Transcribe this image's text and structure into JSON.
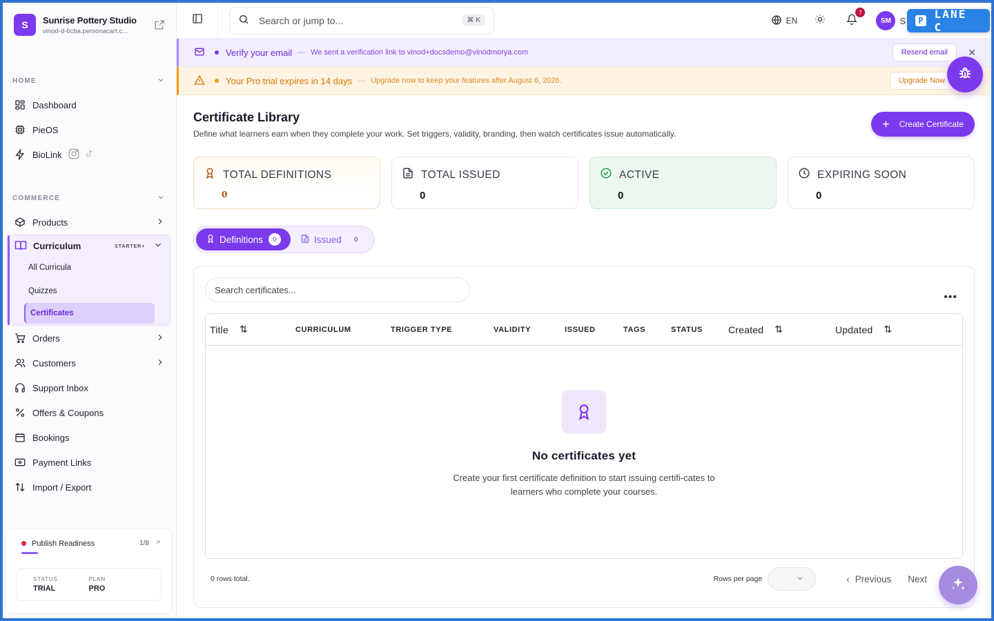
{
  "brand": {
    "initial": "S",
    "name": "Sunrise Pottery Studio",
    "subdomain": "vinod-d-6cba.personacart.c..."
  },
  "sidebar": {
    "home_label": "HOME",
    "commerce_label": "COMMERCE",
    "home_items": [
      {
        "label": "Dashboard",
        "icon": "grid-icon"
      },
      {
        "label": "PieOS",
        "icon": "chip-icon"
      },
      {
        "label": "BioLink",
        "icon": "bolt-icon"
      }
    ],
    "products_label": "Products",
    "curriculum": {
      "label": "Curriculum",
      "badge": "STARTER+",
      "items": [
        "All Curricula",
        "Quizzes",
        "Certificates"
      ]
    },
    "commerce_items": [
      {
        "label": "Orders",
        "has_chevron": true
      },
      {
        "label": "Customers",
        "has_chevron": true
      },
      {
        "label": "Support Inbox"
      },
      {
        "label": "Offers & Coupons"
      },
      {
        "label": "Bookings"
      },
      {
        "label": "Payment Links"
      },
      {
        "label": "Import / Export"
      }
    ],
    "readiness": {
      "label": "Publish Readiness",
      "count": "1/8",
      "progress": 0.125
    },
    "plan": {
      "status_label": "STATUS",
      "status_value": "TRIAL",
      "plan_label": "PLAN",
      "plan_value": "PRO"
    }
  },
  "topbar": {
    "search_placeholder": "Search or jump to...",
    "shortcut": "⌘ K",
    "lang": "EN",
    "notifications": "7",
    "avatar_initials": "SM",
    "avatar_trailing": "S",
    "lane_label": "LANE C",
    "lane_letter": "P"
  },
  "banners": {
    "verify": {
      "title": "Verify your email",
      "sep": "—",
      "text": "We sent a verification link to vinod+docsdemo@vinodmorya.com",
      "button": "Resend email",
      "close": "✕"
    },
    "trial": {
      "title": "Your Pro trial expires in 14 days",
      "sep": "—",
      "text": "Upgrade now to keep your features after August 6, 2026.",
      "button": "Upgrade Now"
    }
  },
  "page": {
    "title": "Certificate Library",
    "description": "Define what learners earn when they complete your work. Set triggers, validity, branding, then watch certificates issue automatically.",
    "create_button": "Create Certificate"
  },
  "stats": [
    {
      "label": "TOTAL DEFINITIONS",
      "value": "0"
    },
    {
      "label": "TOTAL ISSUED",
      "value": "0"
    },
    {
      "label": "ACTIVE",
      "value": "0"
    },
    {
      "label": "EXPIRING SOON",
      "value": "0"
    }
  ],
  "tabs": [
    {
      "label": "Definitions",
      "count": "0"
    },
    {
      "label": "Issued",
      "count": "0"
    }
  ],
  "table": {
    "search_placeholder": "Search certificates...",
    "more": "•••",
    "columns": [
      "Title",
      "CURRICULUM",
      "TRIGGER TYPE",
      "VALIDITY",
      "ISSUED",
      "TAGS",
      "STATUS",
      "Created",
      "Updated"
    ],
    "sort_glyph": "⇅",
    "empty_title": "No certificates yet",
    "empty_desc": "Create your first certificate definition to start issuing certifi-cates to learners who complete your courses."
  },
  "footer": {
    "rows_total": "0 rows total.",
    "rows_per_page": "Rows per page",
    "previous": "Previous",
    "next": "Next"
  },
  "colors": {
    "accent": "#7c3aed",
    "warning": "#d97706",
    "success_bg": "#ecf8ef",
    "frame": "#2f74d0"
  }
}
